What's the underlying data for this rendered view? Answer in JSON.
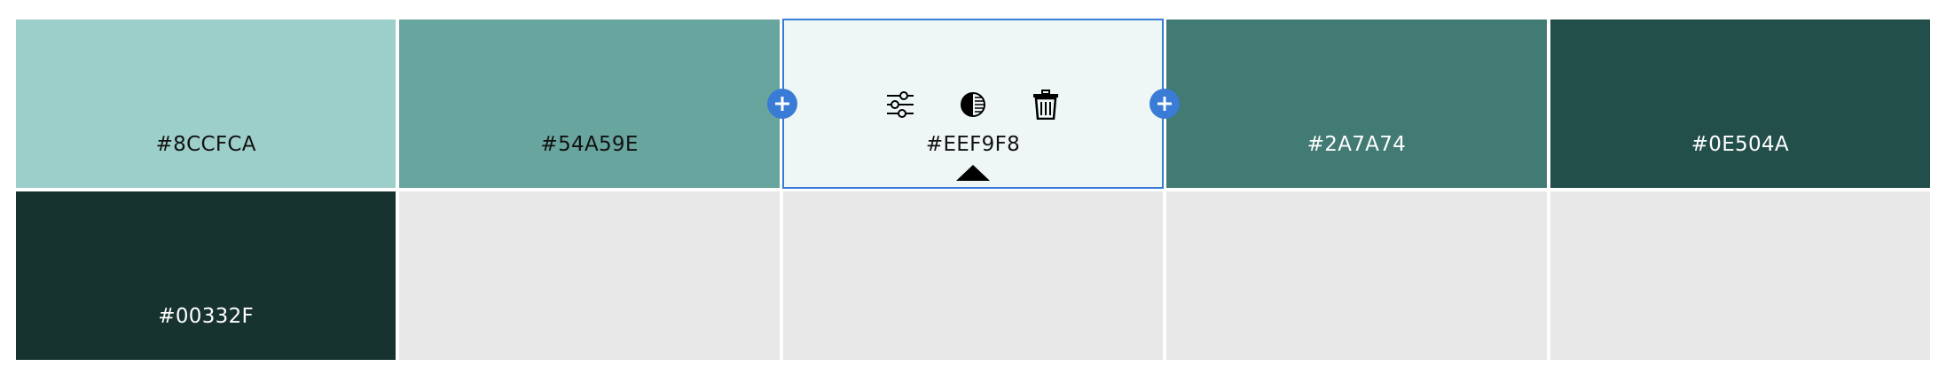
{
  "palette": {
    "swatches": [
      {
        "hex": "#8CCFCA",
        "color": "#9DCFCA",
        "text_color": "#111111"
      },
      {
        "hex": "#54A59E",
        "color": "#68A59E",
        "text_color": "#111111"
      },
      {
        "hex": "#EEF9F8",
        "color": "#EEF7F6",
        "text_color": "#111111"
      },
      {
        "hex": "#2A7A74",
        "color": "#427A74",
        "text_color": "#ffffff"
      },
      {
        "hex": "#0E504A",
        "color": "#234F4B",
        "text_color": "#ffffff"
      },
      {
        "hex": "#00332F",
        "color": "#173330",
        "text_color": "#ffffff"
      }
    ],
    "empty_color": "#E8E8E8",
    "selected_index": 2,
    "accent_color": "#3A7BD5"
  },
  "toolbar": {
    "icons": [
      "adjust-sliders-icon",
      "contrast-icon",
      "trash-icon"
    ]
  },
  "add_button_icon": "plus-icon"
}
